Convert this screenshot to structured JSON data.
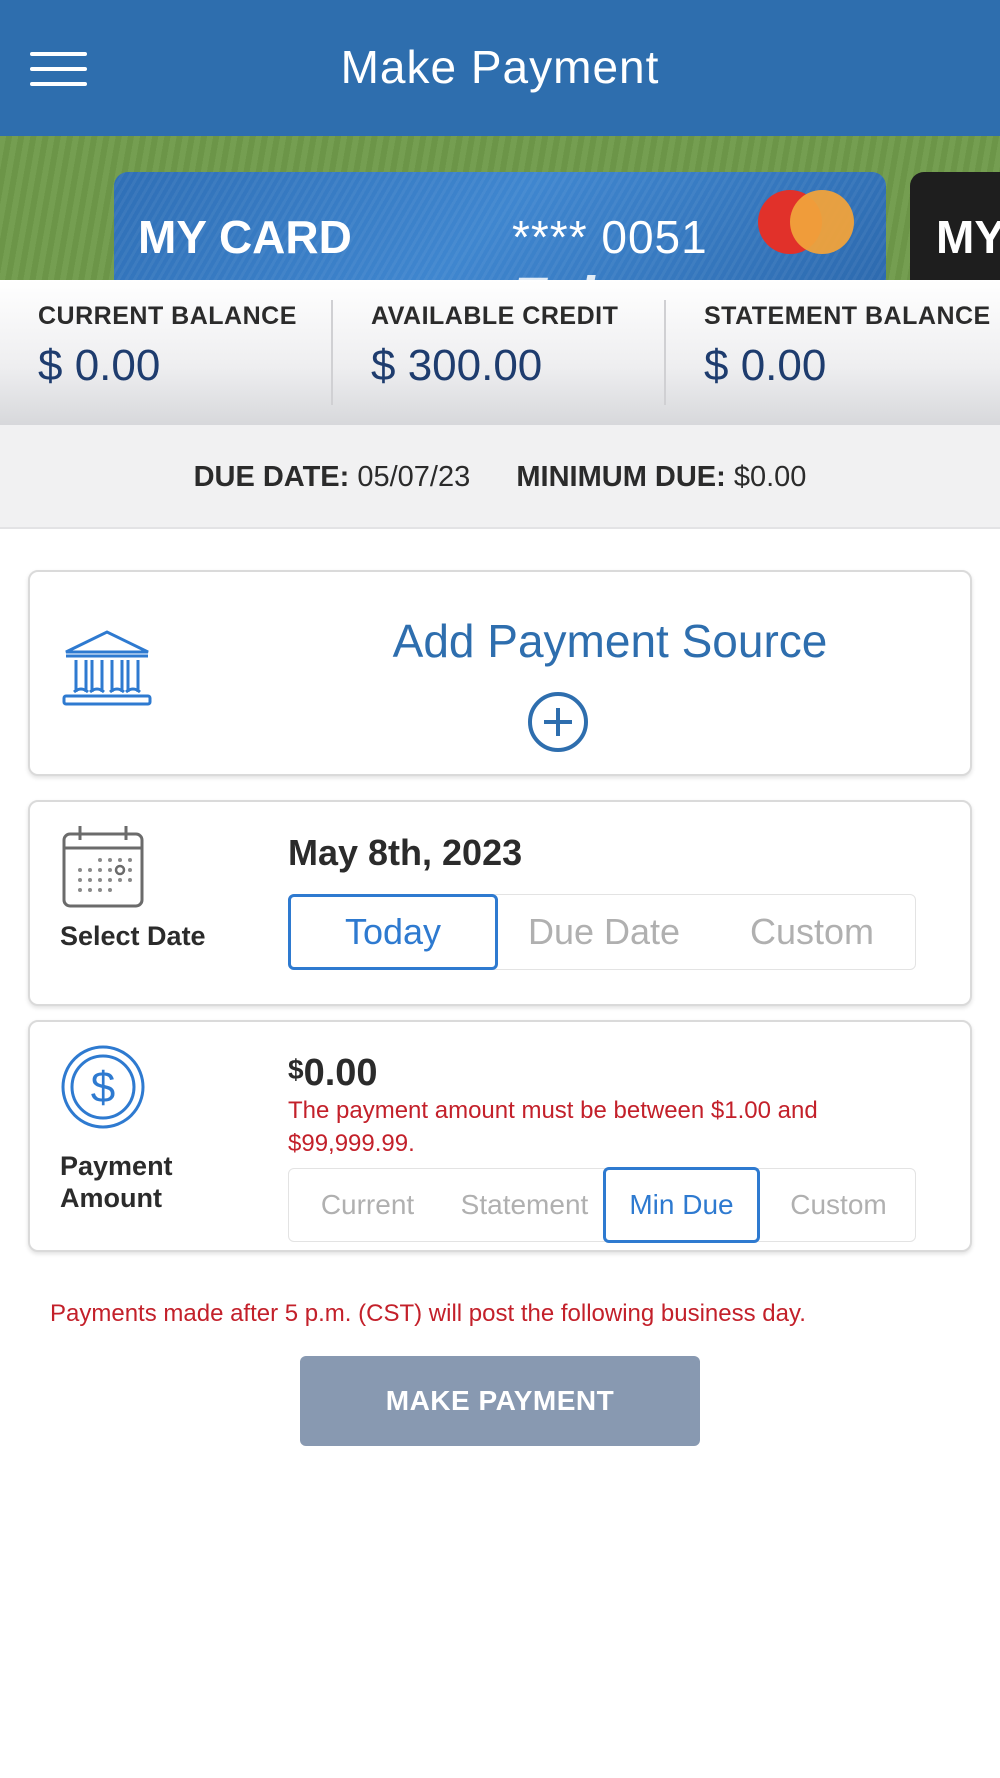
{
  "header": {
    "title": "Make Payment"
  },
  "cards": [
    {
      "name": "MY CARD",
      "number": "**** 0051",
      "watermark": "Frio",
      "color": "#2f6fb6"
    },
    {
      "name": "MY",
      "color": "#1e1e1e"
    }
  ],
  "balances": {
    "current": {
      "label": "CURRENT BALANCE",
      "value": "$ 0.00"
    },
    "available": {
      "label": "AVAILABLE CREDIT",
      "value": "$ 300.00"
    },
    "statement": {
      "label": "STATEMENT BALANCE",
      "value": "$ 0.00"
    }
  },
  "due": {
    "date_label": "DUE DATE:",
    "date_value": "05/07/23",
    "min_label": "MINIMUM DUE:",
    "min_value": "$0.00"
  },
  "payment_source": {
    "title": "Add Payment Source",
    "icon": "bank-icon"
  },
  "date_section": {
    "label": "Select Date",
    "selected_date": "May 8th, 2023",
    "options": [
      "Today",
      "Due Date",
      "Custom"
    ],
    "active_option": "Today"
  },
  "amount_section": {
    "label_line1": "Payment",
    "label_line2": "Amount",
    "currency_symbol": "$",
    "amount": "0.00",
    "error": "The payment amount must be between $1.00 and $99,999.99.",
    "options": [
      "Current",
      "Statement",
      "Min Due",
      "Custom"
    ],
    "active_option": "Min Due"
  },
  "notice": "Payments made after 5 p.m. (CST) will post the following business day.",
  "submit_label": "MAKE PAYMENT",
  "colors": {
    "header": "#2e6eae",
    "accent": "#2e7ad0",
    "error": "#c3202a",
    "button_disabled": "#8899b1",
    "balance_text": "#1e3c6e",
    "carousel_bg": "#6f9a4a"
  }
}
